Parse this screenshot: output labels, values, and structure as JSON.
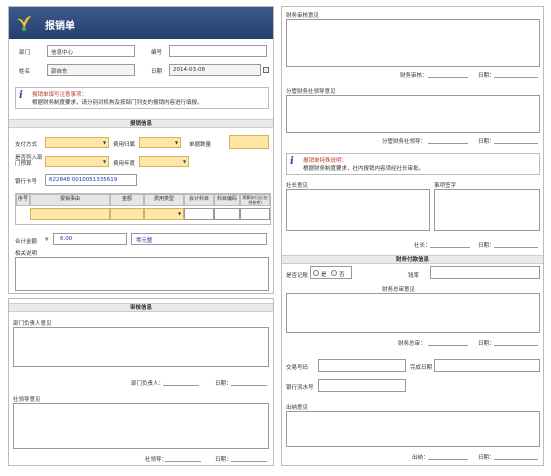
{
  "app": {
    "title": "报销单"
  },
  "basic": {
    "dept_label": "部门",
    "dept_value": "信息中心",
    "code_label": "编号",
    "name_label": "姓名",
    "name_value": "郭自东",
    "date_label": "日期",
    "date_value": "2014-03-08"
  },
  "notice1": {
    "title": "报销单填写注意事项：",
    "text": "根据财务制度要求，请分别对机构及按部门列支的报销内容进行填报。"
  },
  "reimb": {
    "section": "报销信息",
    "pay_label": "支付方式",
    "cost_label": "费用归属",
    "count_label": "单据数量",
    "dept_budget_label": "是否列入部门预算",
    "year_label": "费用年度",
    "bank_label": "银行卡号",
    "bank_value": "622848 0010051335619",
    "columns": [
      "序号",
      "报销事由",
      "金额",
      "费用类型",
      "会计科目",
      "科目编码",
      "预算执行比(仅供参考)"
    ],
    "total_label": "合计金额",
    "currency": "¥",
    "total_value": "6.00",
    "total_upper": "零元整",
    "notes_label": "相关说明"
  },
  "approve": {
    "section": "审核信息",
    "dept_leader_opinion": "部门负责人意见",
    "dept_leader_sign": "部门负责人：",
    "date_label": "日期：",
    "company_opinion": "社领导意见",
    "company_sign": "社领导："
  },
  "right": {
    "finance_opinion": "财务审核意见",
    "finance_sign": "财务审核：",
    "date_label": "日期：",
    "fin_leader_opinion": "分管财务社领导意见",
    "fin_leader_sign": "分管财务社领导：",
    "notice_title": "报销单特殊说明：",
    "notice_text": "根据财务制度要求，社内报销内容须经社长审批。",
    "president_opinion": "社长意见",
    "president_sign": "社长：",
    "affairs_label": "事项签字",
    "payment_section": "财务付款信息",
    "voucher_label": "是否记账",
    "yes_label": "是",
    "no_label": "否",
    "cashier_label": "钱率",
    "fin_director_opinion": "财务总审意见",
    "fin_director_sign": "财务总审：",
    "payment_no_label": "交易号码",
    "complete_date_label": "完成日期",
    "bank_serial_label": "银行流水号",
    "cashier_opinion": "出纳意见",
    "cashier_sign": "出纳："
  },
  "colors": {
    "title_bar": "#2d4a7e",
    "input_yellow": "#fde6a6",
    "notice_red": "#c0392b"
  }
}
